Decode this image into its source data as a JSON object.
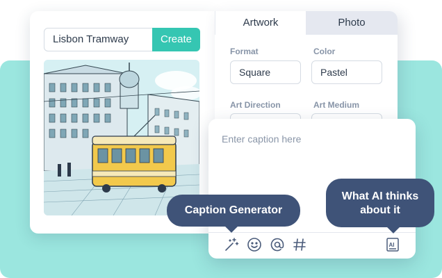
{
  "generator": {
    "prompt_value": "Lisbon Tramway",
    "create_label": "Create"
  },
  "settings": {
    "tabs": [
      {
        "label": "Artwork",
        "active": true
      },
      {
        "label": "Photo",
        "active": false
      }
    ],
    "fields": {
      "format": {
        "label": "Format",
        "value": "Square"
      },
      "color": {
        "label": "Color",
        "value": "Pastel"
      },
      "art_direction": {
        "label": "Art Direction"
      },
      "art_medium": {
        "label": "Art Medium"
      }
    }
  },
  "caption": {
    "placeholder": "Enter caption here",
    "tools": [
      "magic-wand-icon",
      "emoji-icon",
      "at-icon",
      "hashtag-icon",
      "ai-document-icon"
    ]
  },
  "tooltips": {
    "caption_generator": "Caption Generator",
    "ai_line1": "What AI thinks",
    "ai_line2": "about it"
  },
  "colors": {
    "teal_bg": "#9be6df",
    "accent": "#35c6b2",
    "tooltip": "#3f5378",
    "icon": "#4a5b7a"
  }
}
